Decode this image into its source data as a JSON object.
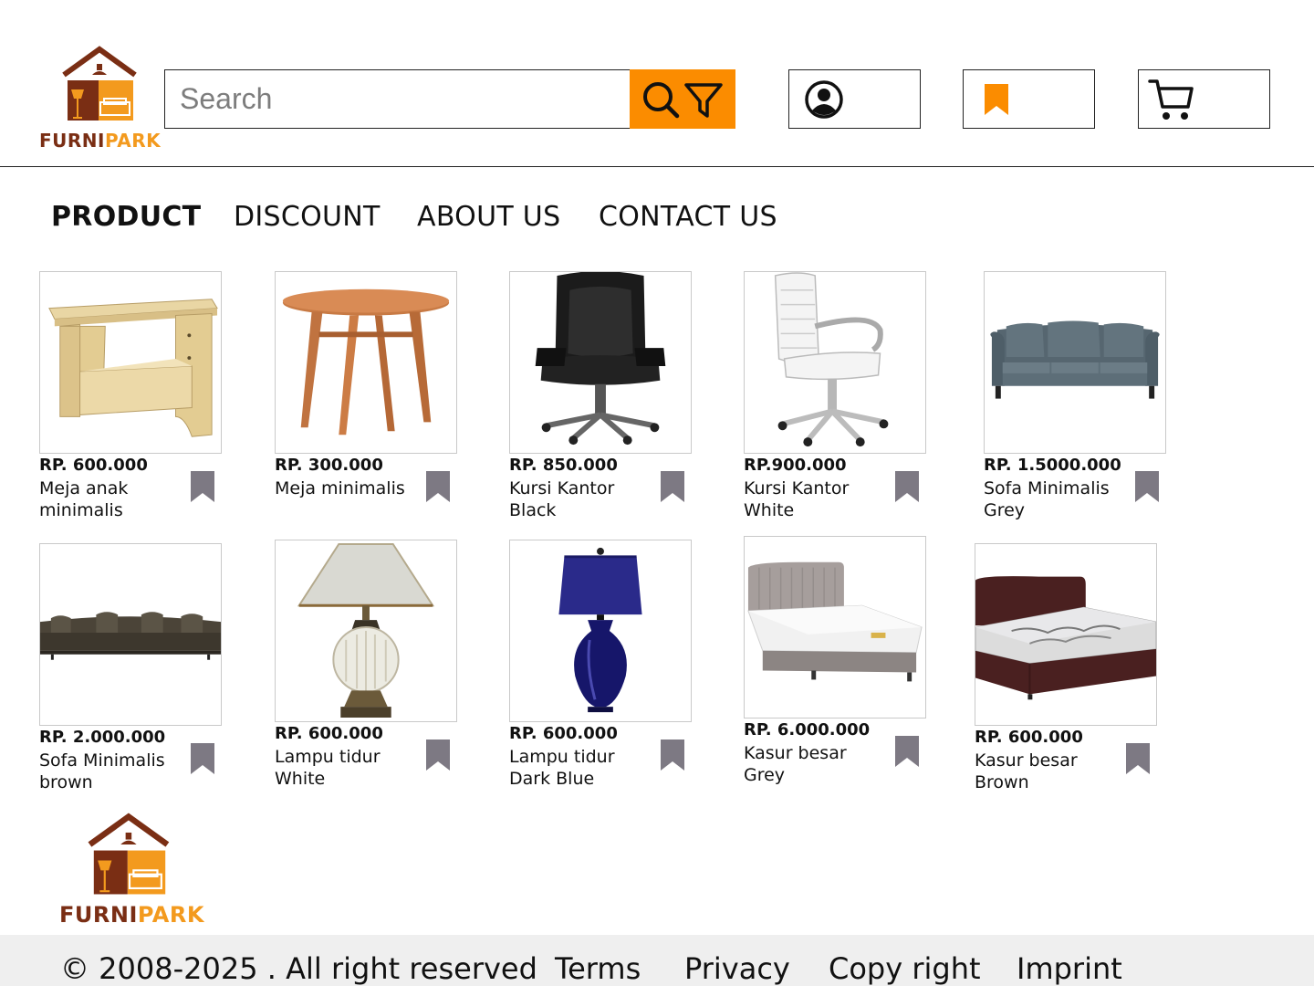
{
  "brand": {
    "name_part1": "FURNI",
    "name_part2": "PARK"
  },
  "search": {
    "placeholder": "Search"
  },
  "header_icons": [
    "search-icon",
    "filter-icon",
    "account-icon",
    "bookmark-icon",
    "cart-icon"
  ],
  "nav": {
    "items": [
      {
        "label": "PRODUCT",
        "active": true
      },
      {
        "label": "DISCOUNT",
        "active": false
      },
      {
        "label": "ABOUT US",
        "active": false
      },
      {
        "label": "CONTACT US",
        "active": false
      }
    ]
  },
  "products": [
    {
      "price": "RP. 600.000",
      "name": "Meja anak minimalis",
      "image": "kids-table"
    },
    {
      "price": "RP. 300.000",
      "name": "Meja minimalis",
      "image": "round-table"
    },
    {
      "price": "RP. 850.000",
      "name": "Kursi Kantor Black",
      "image": "black-office-chair"
    },
    {
      "price": "RP.900.000",
      "name": "Kursi Kantor White",
      "image": "white-office-chair"
    },
    {
      "price": "RP. 1.5000.000",
      "name": "Sofa Minimalis Grey",
      "image": "grey-sofa"
    },
    {
      "price": "RP. 2.000.000",
      "name": "Sofa Minimalis brown",
      "image": "brown-sofa"
    },
    {
      "price": "RP. 600.000",
      "name": "Lampu tidur White",
      "image": "white-lamp"
    },
    {
      "price": "RP. 600.000",
      "name": "Lampu tidur Dark Blue",
      "image": "blue-lamp"
    },
    {
      "price": "RP. 6.000.000",
      "name": "Kasur besar Grey",
      "image": "grey-bed"
    },
    {
      "price": "RP. 600.000",
      "name": "Kasur besar Brown",
      "image": "brown-bed"
    }
  ],
  "footer": {
    "copyright": "© 2008-2025 . All right reserved",
    "links": [
      "Terms",
      "Privacy",
      "Copy right",
      "Imprint"
    ]
  },
  "colors": {
    "accent": "#fb8c00",
    "logo_brown": "#7a2e14",
    "logo_orange": "#f39a1e",
    "bookmark_grey": "#7d7983"
  }
}
